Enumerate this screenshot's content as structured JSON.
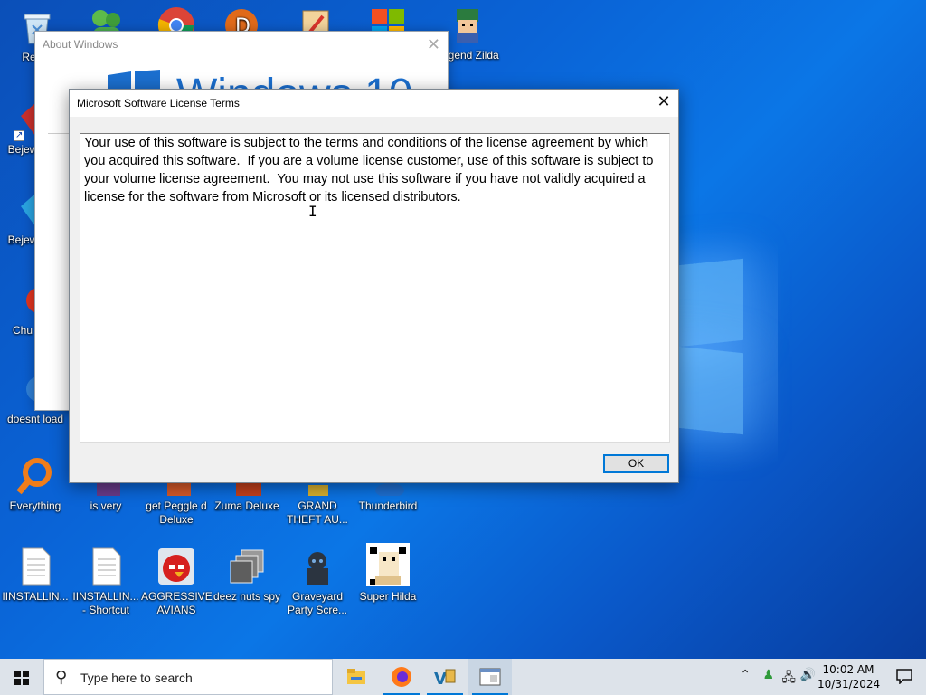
{
  "desktop_icons": [
    {
      "name": "recycle-bin",
      "label": "Recyc"
    },
    {
      "name": "msn",
      "label": ""
    },
    {
      "name": "chrome",
      "label": ""
    },
    {
      "name": "app-d",
      "label": ""
    },
    {
      "name": "app-pencil",
      "label": ""
    },
    {
      "name": "office",
      "label": ""
    },
    {
      "name": "legend-zilda",
      "label": "Legend Zilda"
    },
    {
      "name": "bejeweled-1",
      "label": "Bejew Delu"
    },
    {
      "name": "bejeweled-2",
      "label": "Bejew Delu"
    },
    {
      "name": "chuzzle",
      "label": "Chu Delu"
    },
    {
      "name": "doesnt-load",
      "label": "doesnt load"
    },
    {
      "name": "everything",
      "label": "Everything"
    },
    {
      "name": "is-very",
      "label": "is very"
    },
    {
      "name": "get-peggle",
      "label": "get Peggle d Deluxe"
    },
    {
      "name": "zuma",
      "label": "Zuma Deluxe"
    },
    {
      "name": "gta",
      "label": "GRAND THEFT AU..."
    },
    {
      "name": "thunderbird",
      "label": "Thunderbird"
    },
    {
      "name": "installing-1",
      "label": "IINSTALLIN..."
    },
    {
      "name": "installing-2",
      "label": "IINSTALLIN... - Shortcut"
    },
    {
      "name": "aggressive-avians",
      "label": "AGGRESSIVE AVIANS"
    },
    {
      "name": "deez-nuts-spy",
      "label": "deez nuts spy"
    },
    {
      "name": "graveyard",
      "label": "Graveyard Party Scre..."
    },
    {
      "name": "super-hilda",
      "label": "Super Hilda"
    }
  ],
  "about_window": {
    "title": "About Windows",
    "brand": "Windows 10",
    "close_glyph": "✕"
  },
  "license_dialog": {
    "title": "Microsoft Software License Terms",
    "close_glyph": "✕",
    "body": "Your use of this software is subject to the terms and conditions of the license agreement by which you acquired this software.  If you are a volume license customer, use of this software is subject to your volume license agreement.  You may not use this software if you have not validly acquired a license for the software from Microsoft or its licensed distributors.",
    "ok_label": "OK"
  },
  "taskbar": {
    "search_placeholder": "Type here to search",
    "time": "10:02 AM",
    "date": "10/31/2024",
    "apps": [
      "file-explorer-icon",
      "firefox-icon",
      "vb-icon",
      "dialog-app-icon"
    ]
  },
  "colors": {
    "accent": "#0078d7",
    "desktop": "#0a63d6"
  }
}
